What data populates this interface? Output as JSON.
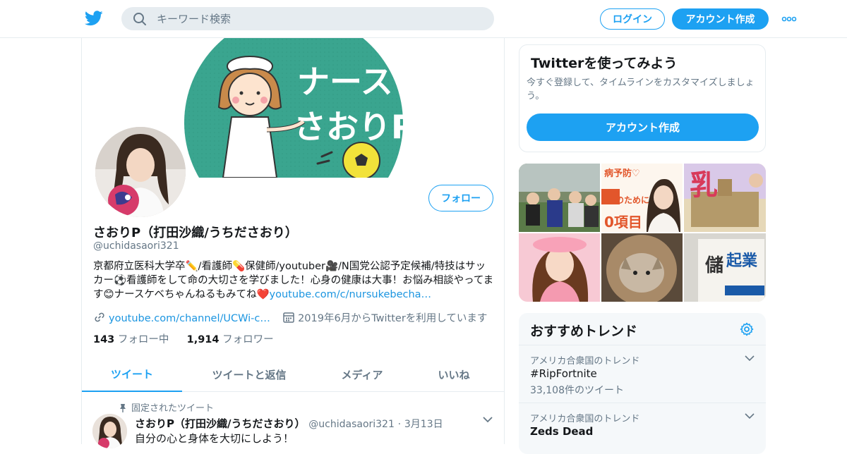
{
  "header": {
    "logo_icon": "twitter-bird-icon",
    "search_placeholder": "キーワード検索",
    "login_label": "ログイン",
    "signup_label": "アカウント作成",
    "more_icon": "more-dots-icon",
    "accent_color": "#1da1f2"
  },
  "banner": {
    "text_line1": "ナース",
    "text_line2": "さおりP"
  },
  "profile": {
    "follow_label": "フォロー",
    "name": "さおりP（打田沙織/うちださおり）",
    "handle": "@uchidasaori321",
    "bio_text": "京都府立医科大学卒✏️/看護師💊保健師/youtuber🎥/N国党公認予定候補/特技はサッカー⚽看護師をして命の大切さを学びました！心身の健康は大事！お悩み相談やってます😊ナースケベちゃんねるもみてね❤️",
    "bio_link": "youtube.com/c/nursukebecha…",
    "website": "youtube.com/channel/UCWi-c…",
    "joined": "2019年6月からTwitterを利用しています",
    "following_count": "143",
    "following_label": "フォロー中",
    "followers_count": "1,914",
    "followers_label": "フォロワー"
  },
  "tabs": [
    {
      "label": "ツイート",
      "active": true
    },
    {
      "label": "ツイートと返信",
      "active": false
    },
    {
      "label": "メディア",
      "active": false
    },
    {
      "label": "いいね",
      "active": false
    }
  ],
  "pinned_tweet": {
    "pinned_label": "固定されたツイート",
    "author_name": "さおりP（打田沙織/うちださおり）",
    "author_handle": "@uchidasaori321",
    "separator": "·",
    "date": "3月13日",
    "text": "自分の心と身体を大切にしよう！"
  },
  "signup_card": {
    "title": "Twitterを使ってみよう",
    "description": "今すぐ登録して、タイムラインをカスタマイズしましょう。",
    "button_label": "アカウント作成"
  },
  "media_grid": {
    "tile2_text_top": "病予防♡",
    "tile2_text_mid": "のために",
    "tile2_text_bottom": "0項目",
    "tile3_text": "乳",
    "tile6_text_top": "儲",
    "tile6_text_bottom": "起業"
  },
  "trends": {
    "title": "おすすめトレンド",
    "items": [
      {
        "context": "アメリカ合衆国のトレンド",
        "name": "#RipFortnite",
        "count": "33,108件のツイート"
      },
      {
        "context": "アメリカ合衆国のトレンド",
        "name": "Zeds Dead",
        "count": ""
      }
    ]
  }
}
